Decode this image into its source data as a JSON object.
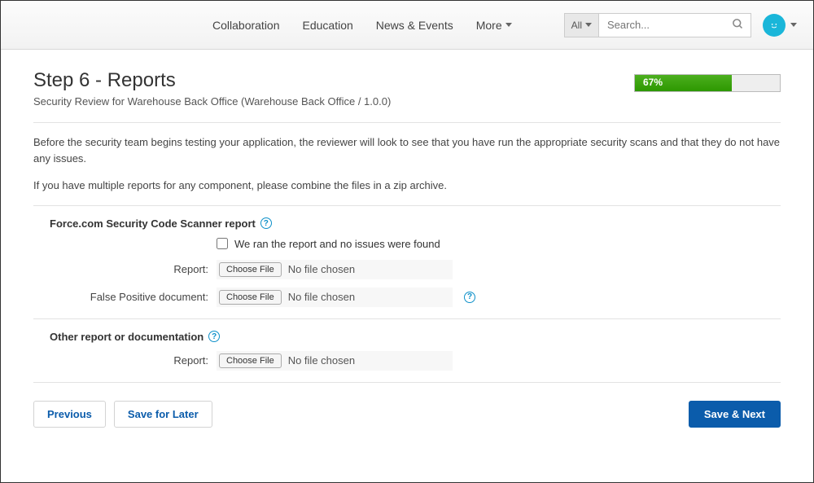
{
  "nav": {
    "links": [
      "Collaboration",
      "Education",
      "News & Events",
      "More"
    ],
    "search_filter": "All",
    "search_placeholder": "Search..."
  },
  "header": {
    "title": "Step 6 - Reports",
    "subtitle": "Security Review for Warehouse Back Office (Warehouse Back Office / 1.0.0)",
    "progress_percent": "67%"
  },
  "intro": {
    "p1": "Before the security team begins testing your application, the reviewer will look to see that you have run the appropriate security scans and that they do not have any issues.",
    "p2": "If you have multiple reports for any component, please combine the files in a zip archive."
  },
  "section1": {
    "title": "Force.com Security Code Scanner report",
    "checkbox_label": "We ran the report and no issues were found",
    "report_label": "Report:",
    "false_positive_label": "False Positive document:",
    "choose_file": "Choose File",
    "no_file": "No file chosen"
  },
  "section2": {
    "title": "Other report or documentation",
    "report_label": "Report:",
    "choose_file": "Choose File",
    "no_file": "No file chosen"
  },
  "footer": {
    "previous": "Previous",
    "save_later": "Save for Later",
    "save_next": "Save & Next"
  }
}
